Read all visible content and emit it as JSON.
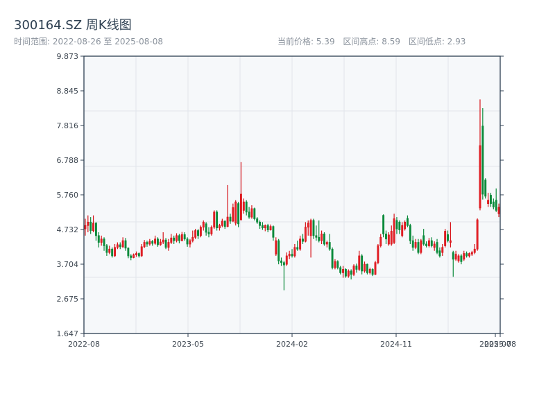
{
  "header": {
    "title": "300164.SZ 周K线图",
    "range_label": "时间范围: 2022-08-26 至 2025-08-08",
    "current_price": "当前价格: 5.39",
    "range_high": "区间高点: 8.59",
    "range_low": "区间低点: 2.93"
  },
  "chart_data": {
    "type": "candlestick",
    "title": "300164.SZ 周K线图",
    "ylim": [
      1.647,
      9.873
    ],
    "yticks": [
      "9.873",
      "8.845",
      "7.816",
      "6.788",
      "5.760",
      "4.732",
      "3.704",
      "2.675",
      "1.647"
    ],
    "xticks": [
      "2022-08",
      "2023-05",
      "2024-02",
      "2024-11",
      "2025-07",
      "2025-08"
    ],
    "grid": true,
    "colors": {
      "up": "#d7141a",
      "down": "#0b8a3b",
      "background": "#f6f8fa",
      "grid": "#e1e5eb",
      "axis": "#2c3e50"
    },
    "ohlc_fields": [
      "open",
      "high",
      "low",
      "close"
    ],
    "candles": [
      [
        4.75,
        5.05,
        4.55,
        4.85
      ],
      [
        4.85,
        5.15,
        4.65,
        4.95
      ],
      [
        4.95,
        5.1,
        4.6,
        4.7
      ],
      [
        4.7,
        5.15,
        4.65,
        4.92
      ],
      [
        4.92,
        4.95,
        4.4,
        4.55
      ],
      [
        4.55,
        4.65,
        4.2,
        4.35
      ],
      [
        4.35,
        4.55,
        4.25,
        4.45
      ],
      [
        4.45,
        4.5,
        4.1,
        4.25
      ],
      [
        4.25,
        4.3,
        3.95,
        4.05
      ],
      [
        4.05,
        4.25,
        4.0,
        4.15
      ],
      [
        4.15,
        4.2,
        3.9,
        3.95
      ],
      [
        3.95,
        4.3,
        3.92,
        4.2
      ],
      [
        4.2,
        4.35,
        4.15,
        4.28
      ],
      [
        4.28,
        4.35,
        4.15,
        4.22
      ],
      [
        4.22,
        4.5,
        4.18,
        4.4
      ],
      [
        4.4,
        4.48,
        4.1,
        4.18
      ],
      [
        4.18,
        4.2,
        3.88,
        3.95
      ],
      [
        3.95,
        4.0,
        3.82,
        3.9
      ],
      [
        3.9,
        4.02,
        3.88,
        3.98
      ],
      [
        3.98,
        4.08,
        3.92,
        4.02
      ],
      [
        4.02,
        4.05,
        3.9,
        3.95
      ],
      [
        3.95,
        4.3,
        3.92,
        4.22
      ],
      [
        4.22,
        4.42,
        4.18,
        4.35
      ],
      [
        4.35,
        4.4,
        4.22,
        4.3
      ],
      [
        4.3,
        4.45,
        4.25,
        4.38
      ],
      [
        4.38,
        4.42,
        4.25,
        4.32
      ],
      [
        4.32,
        4.55,
        4.28,
        4.45
      ],
      [
        4.45,
        4.5,
        4.22,
        4.28
      ],
      [
        4.28,
        4.45,
        4.25,
        4.36
      ],
      [
        4.36,
        4.65,
        4.3,
        4.42
      ],
      [
        4.42,
        4.48,
        4.15,
        4.2
      ],
      [
        4.2,
        4.45,
        4.1,
        4.35
      ],
      [
        4.35,
        4.6,
        4.3,
        4.48
      ],
      [
        4.48,
        4.55,
        4.3,
        4.4
      ],
      [
        4.4,
        4.62,
        4.35,
        4.55
      ],
      [
        4.55,
        4.6,
        4.32,
        4.4
      ],
      [
        4.4,
        4.66,
        4.38,
        4.58
      ],
      [
        4.58,
        4.65,
        4.4,
        4.45
      ],
      [
        4.45,
        4.5,
        4.22,
        4.3
      ],
      [
        4.3,
        4.45,
        4.2,
        4.4
      ],
      [
        4.4,
        4.7,
        4.35,
        4.5
      ],
      [
        4.5,
        4.75,
        4.45,
        4.7
      ],
      [
        4.7,
        4.75,
        4.45,
        4.55
      ],
      [
        4.55,
        4.85,
        4.5,
        4.8
      ],
      [
        4.8,
        5.0,
        4.7,
        4.95
      ],
      [
        4.9,
        4.95,
        4.55,
        4.65
      ],
      [
        4.65,
        4.8,
        4.5,
        4.6
      ],
      [
        4.6,
        4.85,
        4.55,
        4.8
      ],
      [
        4.8,
        5.3,
        4.75,
        5.25
      ],
      [
        5.25,
        5.3,
        4.7,
        4.78
      ],
      [
        4.78,
        4.9,
        4.7,
        4.85
      ],
      [
        4.85,
        5.05,
        4.8,
        4.98
      ],
      [
        4.98,
        5.0,
        4.75,
        4.82
      ],
      [
        4.82,
        6.05,
        4.8,
        5.1
      ],
      [
        5.1,
        5.2,
        4.9,
        4.98
      ],
      [
        4.98,
        5.5,
        4.95,
        5.38
      ],
      [
        4.92,
        5.6,
        4.85,
        5.55
      ],
      [
        5.5,
        5.55,
        4.8,
        4.9
      ],
      [
        5.02,
        6.73,
        5.0,
        5.78
      ],
      [
        5.3,
        5.65,
        5.2,
        5.55
      ],
      [
        5.55,
        5.6,
        5.15,
        5.25
      ],
      [
        5.25,
        5.4,
        5.05,
        5.1
      ],
      [
        5.1,
        5.45,
        5.05,
        5.35
      ],
      [
        5.35,
        5.38,
        5.0,
        5.05
      ],
      [
        5.05,
        5.1,
        4.9,
        4.95
      ],
      [
        4.95,
        5.0,
        4.75,
        4.85
      ],
      [
        4.85,
        4.95,
        4.72,
        4.78
      ],
      [
        4.78,
        4.88,
        4.68,
        4.85
      ],
      [
        4.85,
        4.9,
        4.65,
        4.72
      ],
      [
        4.72,
        4.88,
        4.7,
        4.82
      ],
      [
        4.82,
        4.85,
        4.4,
        4.5
      ],
      [
        4.0,
        4.5,
        3.95,
        4.4
      ],
      [
        4.4,
        4.45,
        3.7,
        3.8
      ],
      [
        3.8,
        3.9,
        3.65,
        3.75
      ],
      [
        3.75,
        3.8,
        2.93,
        3.68
      ],
      [
        3.7,
        4.05,
        3.65,
        3.95
      ],
      [
        3.95,
        4.1,
        3.85,
        4.0
      ],
      [
        4.0,
        4.15,
        3.9,
        3.95
      ],
      [
        3.95,
        4.3,
        3.9,
        4.2
      ],
      [
        4.2,
        4.4,
        4.1,
        4.15
      ],
      [
        4.15,
        4.55,
        4.1,
        4.45
      ],
      [
        4.45,
        4.6,
        4.3,
        4.38
      ],
      [
        4.38,
        4.95,
        4.35,
        4.8
      ],
      [
        4.8,
        5.0,
        4.55,
        4.92
      ],
      [
        4.55,
        5.05,
        3.9,
        5.0
      ],
      [
        5.0,
        5.05,
        4.45,
        4.55
      ],
      [
        4.55,
        4.85,
        4.4,
        4.5
      ],
      [
        4.5,
        5.0,
        4.35,
        4.4
      ],
      [
        4.4,
        4.7,
        4.3,
        4.6
      ],
      [
        4.6,
        4.65,
        4.25,
        4.3
      ],
      [
        4.3,
        4.4,
        4.2,
        4.35
      ],
      [
        4.35,
        4.6,
        4.1,
        4.15
      ],
      [
        4.15,
        4.2,
        3.55,
        3.6
      ],
      [
        3.6,
        3.85,
        3.55,
        3.78
      ],
      [
        3.78,
        3.82,
        3.55,
        3.6
      ],
      [
        3.6,
        3.65,
        3.4,
        3.45
      ],
      [
        3.45,
        3.65,
        3.3,
        3.55
      ],
      [
        3.55,
        3.58,
        3.3,
        3.35
      ],
      [
        3.35,
        3.55,
        3.3,
        3.5
      ],
      [
        3.5,
        3.55,
        3.25,
        3.4
      ],
      [
        3.4,
        3.7,
        3.35,
        3.65
      ],
      [
        3.65,
        3.72,
        3.45,
        3.55
      ],
      [
        3.55,
        4.1,
        3.5,
        3.95
      ],
      [
        3.95,
        4.0,
        3.4,
        3.5
      ],
      [
        3.5,
        3.78,
        3.45,
        3.7
      ],
      [
        3.7,
        3.72,
        3.4,
        3.45
      ],
      [
        3.45,
        3.6,
        3.4,
        3.55
      ],
      [
        3.55,
        3.58,
        3.35,
        3.4
      ],
      [
        3.4,
        3.8,
        3.38,
        3.75
      ],
      [
        3.75,
        4.3,
        3.7,
        4.25
      ],
      [
        4.25,
        4.6,
        4.2,
        4.5
      ],
      [
        5.15,
        5.18,
        4.5,
        4.6
      ],
      [
        4.6,
        4.7,
        4.3,
        4.45
      ],
      [
        4.3,
        4.65,
        4.25,
        4.57
      ],
      [
        4.3,
        4.85,
        4.25,
        4.68
      ],
      [
        4.35,
        5.2,
        4.3,
        5.05
      ],
      [
        5.0,
        5.1,
        4.6,
        4.75
      ],
      [
        4.95,
        5.0,
        4.6,
        4.72
      ],
      [
        4.55,
        4.95,
        4.5,
        4.85
      ],
      [
        4.75,
        5.0,
        4.7,
        4.95
      ],
      [
        5.06,
        5.15,
        4.8,
        4.85
      ],
      [
        4.85,
        4.9,
        4.3,
        4.4
      ],
      [
        4.4,
        4.55,
        4.1,
        4.2
      ],
      [
        4.2,
        4.45,
        4.15,
        4.35
      ],
      [
        4.35,
        4.45,
        4.0,
        4.05
      ],
      [
        4.05,
        4.45,
        4.0,
        4.4
      ],
      [
        4.55,
        4.75,
        4.25,
        4.3
      ],
      [
        4.3,
        4.38,
        4.2,
        4.25
      ],
      [
        4.25,
        4.48,
        4.2,
        4.4
      ],
      [
        4.4,
        4.5,
        4.2,
        4.25
      ],
      [
        4.2,
        4.38,
        4.1,
        4.3
      ],
      [
        4.35,
        4.45,
        4.0,
        4.05
      ],
      [
        4.1,
        4.2,
        3.9,
        3.95
      ],
      [
        4.05,
        4.3,
        3.95,
        4.2
      ],
      [
        4.25,
        4.75,
        4.2,
        4.68
      ],
      [
        4.58,
        4.7,
        4.35,
        4.4
      ],
      [
        4.35,
        4.95,
        4.2,
        4.4
      ],
      [
        4.05,
        4.1,
        3.33,
        3.85
      ],
      [
        3.85,
        4.1,
        3.8,
        4.0
      ],
      [
        3.8,
        4.0,
        3.75,
        3.95
      ],
      [
        3.95,
        4.0,
        3.7,
        3.78
      ],
      [
        3.85,
        4.1,
        3.8,
        4.02
      ],
      [
        4.02,
        4.08,
        3.9,
        3.95
      ],
      [
        3.95,
        4.05,
        3.9,
        4.02
      ],
      [
        4.0,
        4.1,
        3.95,
        4.05
      ],
      [
        4.05,
        4.3,
        4.0,
        4.15
      ],
      [
        4.15,
        5.06,
        4.1,
        5.02
      ],
      [
        5.37,
        8.59,
        5.3,
        7.22
      ],
      [
        7.8,
        8.33,
        5.62,
        5.78
      ],
      [
        6.2,
        6.25,
        5.65,
        5.72
      ],
      [
        5.5,
        5.82,
        5.4,
        5.6
      ],
      [
        5.75,
        5.82,
        5.4,
        5.5
      ],
      [
        5.55,
        5.65,
        5.33,
        5.4
      ],
      [
        5.6,
        5.95,
        5.25,
        5.3
      ],
      [
        5.2,
        5.5,
        5.1,
        5.39
      ]
    ]
  }
}
